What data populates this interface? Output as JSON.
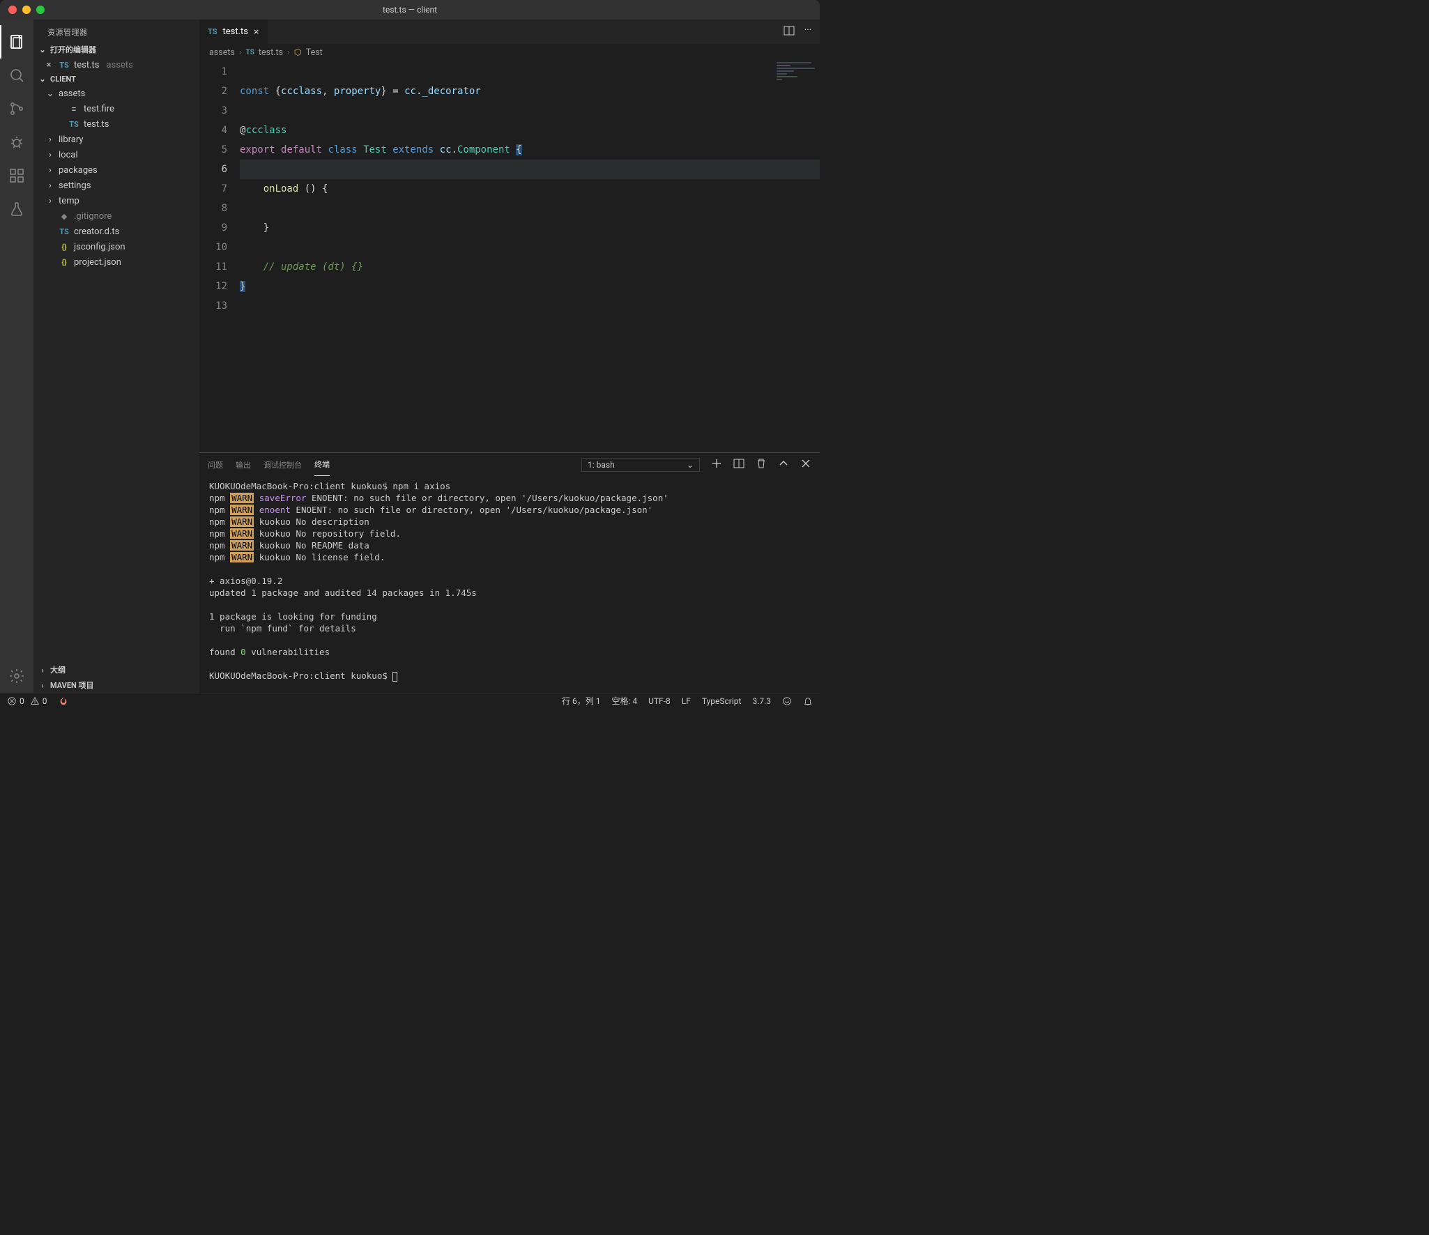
{
  "window": {
    "title": "test.ts — client"
  },
  "sidebar": {
    "explorer_title": "资源管理器",
    "section_open_editors": "打开的编辑器",
    "section_project": "CLIENT",
    "section_outline": "大纲",
    "section_maven": "MAVEN 项目",
    "open_editors": [
      {
        "icon": "TS",
        "name": "test.ts",
        "path": "assets"
      }
    ],
    "tree": [
      {
        "type": "folder",
        "open": true,
        "depth": 0,
        "name": "assets"
      },
      {
        "type": "file",
        "icon": "≡",
        "depth": 1,
        "name": "test.fire"
      },
      {
        "type": "file",
        "icon": "TS",
        "depth": 1,
        "name": "test.ts"
      },
      {
        "type": "folder",
        "open": false,
        "depth": 0,
        "name": "library"
      },
      {
        "type": "folder",
        "open": false,
        "depth": 0,
        "name": "local"
      },
      {
        "type": "folder",
        "open": false,
        "depth": 0,
        "name": "packages"
      },
      {
        "type": "folder",
        "open": false,
        "depth": 0,
        "name": "settings"
      },
      {
        "type": "folder",
        "open": false,
        "depth": 0,
        "name": "temp"
      },
      {
        "type": "file",
        "icon": "◆",
        "depth": 0,
        "name": ".gitignore",
        "dim": true
      },
      {
        "type": "file",
        "icon": "TS",
        "depth": 0,
        "name": "creator.d.ts"
      },
      {
        "type": "file",
        "icon": "{}",
        "depth": 0,
        "name": "jsconfig.json"
      },
      {
        "type": "file",
        "icon": "{}",
        "depth": 0,
        "name": "project.json"
      }
    ]
  },
  "tabs": [
    {
      "icon": "TS",
      "label": "test.ts"
    }
  ],
  "breadcrumb": {
    "seg1": "assets",
    "seg2_icon": "TS",
    "seg2": "test.ts",
    "seg3": "Test"
  },
  "editor": {
    "line_count": 13,
    "current_line": 6,
    "lines_html": [
      "",
      "<span class='tok-kw2'>const</span> <span class='tok-pun'>{</span><span class='tok-var'>ccclass</span><span class='tok-pun'>,</span> <span class='tok-var'>property</span><span class='tok-pun'>}</span> <span class='tok-pun'>=</span> <span class='tok-var'>cc</span><span class='tok-pun'>.</span><span class='tok-var'>_decorator</span>",
      "",
      "<span class='tok-pun'>@</span><span class='tok-dec'>ccclass</span>",
      "<span class='tok-kw'>export</span> <span class='tok-kw'>default</span> <span class='tok-kw2'>class</span> <span class='tok-type'>Test</span> <span class='tok-kw2'>extends</span> <span class='tok-var'>cc</span><span class='tok-pun'>.</span><span class='tok-type'>Component</span> <span class='tok-pun cursor-block'>{</span>",
      "",
      "    <span class='tok-fn'>onLoad</span> <span class='tok-pun'>() {</span>",
      "",
      "    <span class='tok-pun'>}</span>",
      "",
      "    <span class='tok-com'>// update (dt) {}</span>",
      "<span class='tok-pun cursor-block'>}</span>",
      ""
    ]
  },
  "panel": {
    "tabs": {
      "problems": "问题",
      "output": "输出",
      "debug": "调试控制台",
      "terminal": "终端"
    },
    "terminal_selector": "1: bash",
    "terminal_lines": [
      {
        "plain": "KUOKUOdeMacBook-Pro:client kuokuo$ npm i axios"
      },
      {
        "seg": [
          "npm ",
          {
            "cls": "t-warn",
            "t": "WARN"
          },
          " ",
          {
            "cls": "t-purp",
            "t": "saveError"
          },
          " ENOENT: no such file or directory, open '/Users/kuokuo/package.json'"
        ]
      },
      {
        "seg": [
          "npm ",
          {
            "cls": "t-warn",
            "t": "WARN"
          },
          " ",
          {
            "cls": "t-purp",
            "t": "enoent"
          },
          " ENOENT: no such file or directory, open '/Users/kuokuo/package.json'"
        ]
      },
      {
        "seg": [
          "npm ",
          {
            "cls": "t-warn",
            "t": "WARN"
          },
          " kuokuo No description"
        ]
      },
      {
        "seg": [
          "npm ",
          {
            "cls": "t-warn",
            "t": "WARN"
          },
          " kuokuo No repository field."
        ]
      },
      {
        "seg": [
          "npm ",
          {
            "cls": "t-warn",
            "t": "WARN"
          },
          " kuokuo No README data"
        ]
      },
      {
        "seg": [
          "npm ",
          {
            "cls": "t-warn",
            "t": "WARN"
          },
          " kuokuo No license field."
        ]
      },
      {
        "plain": ""
      },
      {
        "plain": "+ axios@0.19.2"
      },
      {
        "plain": "updated 1 package and audited 14 packages in 1.745s"
      },
      {
        "plain": ""
      },
      {
        "plain": "1 package is looking for funding"
      },
      {
        "plain": "  run `npm fund` for details"
      },
      {
        "plain": ""
      },
      {
        "seg": [
          "found ",
          {
            "cls": "t-green",
            "t": "0"
          },
          " vulnerabilities"
        ]
      },
      {
        "plain": ""
      },
      {
        "seg": [
          "KUOKUOdeMacBook-Pro:client kuokuo$ ",
          {
            "cursor": true
          }
        ]
      }
    ]
  },
  "statusbar": {
    "errors": "0",
    "warnings": "0",
    "ln_col": "行 6，列 1",
    "spaces": "空格: 4",
    "encoding": "UTF-8",
    "eol": "LF",
    "language": "TypeScript",
    "version": "3.7.3"
  }
}
